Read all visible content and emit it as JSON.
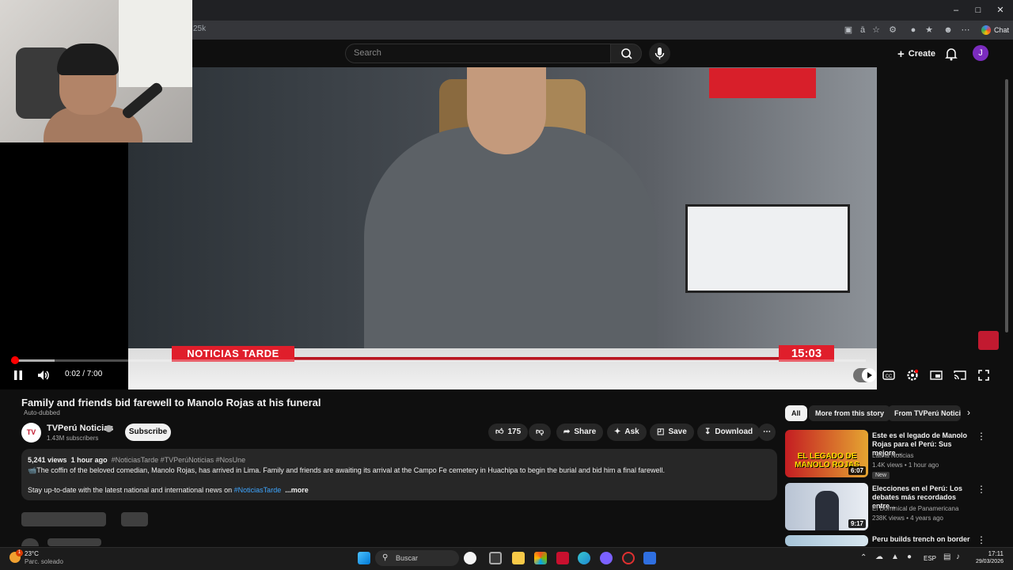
{
  "browser": {
    "url_fragment": "25k",
    "chat_label": "Chat"
  },
  "header": {
    "search_placeholder": "Search",
    "create_label": "Create",
    "avatar_letter": "J"
  },
  "video": {
    "lower_third_left": "NOTICIAS TARDE",
    "lower_third_time": "15:03",
    "timecode": "0:02 / 7:00",
    "progress_fraction": 0.005
  },
  "info": {
    "title": "Family and friends bid farewell to Manolo Rojas at his funeral",
    "auto_dubbed": "Auto-dubbed",
    "channel_logo_text": "TV",
    "channel_name": "TVPerú Noticias",
    "subscribers": "1.43M subscribers",
    "subscribe_label": "Subscribe",
    "like_count": "175",
    "share_label": "Share",
    "ask_label": "Ask",
    "save_label": "Save",
    "download_label": "Download"
  },
  "description": {
    "views": "5,241 views",
    "age": "1 hour ago",
    "hashtags": "#NoticiasTarde #TVPerúNoticias #NosUne",
    "line1": "📹The coffin of the beloved comedian, Manolo Rojas, has arrived in Lima. Family and friends are awaiting its arrival at the Campo Fe cemetery in Huachipa to begin the burial and bid him a final farewell.",
    "line2_prefix": "Stay up-to-date with the latest national and international news on ",
    "line2_link": "#NoticiasTarde",
    "more_label": "...more"
  },
  "sidebar": {
    "chips": [
      "All",
      "More from this story",
      "From TVPerú Noticias"
    ],
    "items": [
      {
        "title": "Este es el legado de Manolo Rojas para el Perú: Sus mejore...",
        "channel": "Latina Noticias",
        "meta": "1.4K views • 1 hour ago",
        "badge": "New",
        "duration": "6:07",
        "thumb_text": "EL LEGADO DE MANOLO ROJAS"
      },
      {
        "title": "Elecciones en el Perú: Los debates más recordados entre...",
        "channel": "El Dominical de Panamericana",
        "meta": "238K views • 4 years ago",
        "duration": "9:17"
      },
      {
        "title": "Peru builds trench on border"
      }
    ]
  },
  "taskbar": {
    "temperature": "23°C",
    "weather": "Parc. soleado",
    "weather_badge": "1",
    "search_label": "Buscar",
    "language": "ESP",
    "time": "17:11",
    "date": "29/03/2026"
  },
  "colors": {
    "accent_red": "#ff0000",
    "news_red": "#e01e2b",
    "link_blue": "#3ea6ff",
    "bg": "#0f0f0f"
  }
}
